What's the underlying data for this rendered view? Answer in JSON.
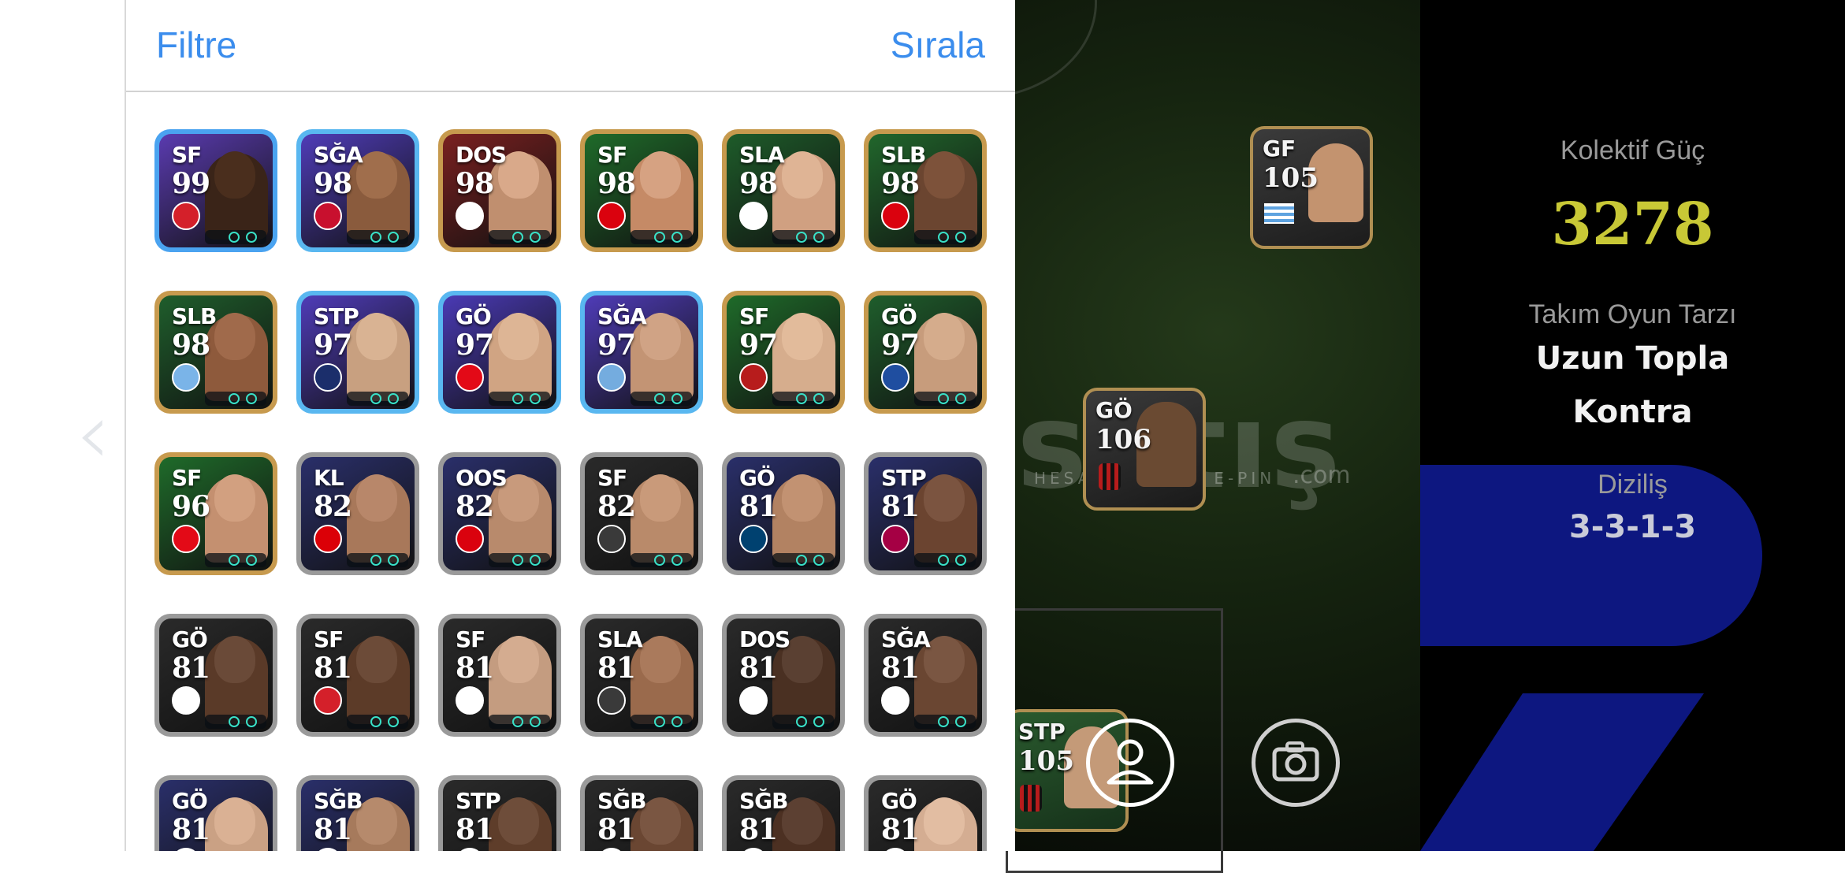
{
  "header": {
    "filter_label": "Filtre",
    "sort_label": "Sırala"
  },
  "players": [
    {
      "pos": "SF",
      "rating": "99",
      "bg": "#5a3bb0",
      "frame": "#4aa3f0",
      "face": "#3a2418",
      "head": "#4a2e1d",
      "badge": "#d4202a",
      "badge_icon": "galatasaray-badge-icon"
    },
    {
      "pos": "SĞA",
      "rating": "98",
      "bg": "#4f3cb8",
      "frame": "#59b7f0",
      "face": "#8a5b3d",
      "head": "#a06e4c",
      "badge": "#c8102e",
      "badge_icon": "portugal-flag-icon"
    },
    {
      "pos": "DOS",
      "rating": "98",
      "bg": "#7a2020",
      "frame": "#c79a4e",
      "face": "#c08f6f",
      "head": "#d9a98a",
      "badge": "#ffffff",
      "badge_icon": "ajax-badge-icon"
    },
    {
      "pos": "SF",
      "rating": "98",
      "bg": "#1f6b2a",
      "frame": "#c79a4e",
      "face": "#c58a66",
      "head": "#d6a282",
      "badge": "#da020e",
      "badge_icon": "man-united-badge-icon"
    },
    {
      "pos": "SLA",
      "rating": "98",
      "bg": "#1e5c2a",
      "frame": "#c79a4e",
      "face": "#d0a081",
      "head": "#dfb495",
      "badge": "#ffffff",
      "badge_icon": "club-badge-icon"
    },
    {
      "pos": "SLB",
      "rating": "98",
      "bg": "#21672c",
      "frame": "#c79a4e",
      "face": "#6b4530",
      "head": "#7d523a",
      "badge": "#da020e",
      "badge_icon": "man-united-badge-icon"
    },
    {
      "pos": "SLB",
      "rating": "98",
      "bg": "#1f5e2c",
      "frame": "#c79a4e",
      "face": "#8e5a3c",
      "head": "#a06a4b",
      "badge": "#7ab4e8",
      "badge_icon": "uruguay-flag-icon"
    },
    {
      "pos": "STP",
      "rating": "97",
      "bg": "#4f3cb8",
      "frame": "#59b7f0",
      "face": "#c8a080",
      "head": "#d9b393",
      "badge": "#1b2e6b",
      "badge_icon": "fenerbahce-badge-icon"
    },
    {
      "pos": "GÖ",
      "rating": "97",
      "bg": "#4a3ab5",
      "frame": "#59b7f0",
      "face": "#d0a483",
      "head": "#ddb595",
      "badge": "#e30a17",
      "badge_icon": "turkey-flag-icon"
    },
    {
      "pos": "SĞA",
      "rating": "97",
      "bg": "#4f3cb8",
      "frame": "#59b7f0",
      "face": "#c39474",
      "head": "#d0a385",
      "badge": "#74acdf",
      "badge_icon": "argentina-flag-icon"
    },
    {
      "pos": "SF",
      "rating": "97",
      "bg": "#1f6b2a",
      "frame": "#c79a4e",
      "face": "#d6ad8d",
      "head": "#e2bb9b",
      "badge": "#b71c1c",
      "badge_icon": "ac-milan-badge-icon"
    },
    {
      "pos": "GÖ",
      "rating": "97",
      "bg": "#1f5e2c",
      "frame": "#c79a4e",
      "face": "#c79c7c",
      "head": "#d5ac8c",
      "badge": "#1f4ea0",
      "badge_icon": "la-galaxy-badge-icon"
    },
    {
      "pos": "SF",
      "rating": "96",
      "bg": "#1f6b2a",
      "frame": "#c79a4e",
      "face": "#c49070",
      "head": "#d2a080",
      "badge": "#e30a17",
      "badge_icon": "turkey-flag-icon"
    },
    {
      "pos": "KL",
      "rating": "82",
      "bg": "#2a2f6a",
      "frame": "#9a9a9a",
      "face": "#a8785a",
      "head": "#b8876a",
      "badge": "#db0007",
      "badge_icon": "arsenal-badge-icon"
    },
    {
      "pos": "OOS",
      "rating": "82",
      "bg": "#2a2f6a",
      "frame": "#9a9a9a",
      "face": "#b88a6c",
      "head": "#c89a7c",
      "badge": "#da020e",
      "badge_icon": "man-united-badge-icon"
    },
    {
      "pos": "SF",
      "rating": "82",
      "bg": "#2a2a2a",
      "frame": "#9a9a9a",
      "face": "#b98a6a",
      "head": "#c99a7a",
      "badge": "#3a3a3a",
      "badge_icon": "shield-icon"
    },
    {
      "pos": "GÖ",
      "rating": "81",
      "bg": "#2a2f6a",
      "frame": "#9a9a9a",
      "face": "#b28262",
      "head": "#c29272",
      "badge": "#004170",
      "badge_icon": "psg-badge-icon"
    },
    {
      "pos": "STP",
      "rating": "81",
      "bg": "#2a2f6a",
      "frame": "#9a9a9a",
      "face": "#6b4430",
      "head": "#7b5440",
      "badge": "#a50044",
      "badge_icon": "barcelona-badge-icon"
    },
    {
      "pos": "GÖ",
      "rating": "81",
      "bg": "#2a2a2a",
      "frame": "#9a9a9a",
      "face": "#5a3a28",
      "head": "#6a4a38",
      "badge": "#ffffff",
      "badge_icon": "club-badge-icon"
    },
    {
      "pos": "SF",
      "rating": "81",
      "bg": "#2a2a2a",
      "frame": "#9a9a9a",
      "face": "#5c3b28",
      "head": "#6c4b38",
      "badge": "#d4202a",
      "badge_icon": "galatasaray-badge-icon"
    },
    {
      "pos": "SF",
      "rating": "81",
      "bg": "#2a2a2a",
      "frame": "#9a9a9a",
      "face": "#c49c80",
      "head": "#d4ac90",
      "badge": "#ffffff",
      "badge_icon": "club-badge-icon"
    },
    {
      "pos": "SLA",
      "rating": "81",
      "bg": "#2a2a2a",
      "frame": "#9a9a9a",
      "face": "#9a6a4c",
      "head": "#aa7a5c",
      "badge": "#3a3a3a",
      "badge_icon": "shield-icon"
    },
    {
      "pos": "DOS",
      "rating": "81",
      "bg": "#2a2a2a",
      "frame": "#9a9a9a",
      "face": "#4a3022",
      "head": "#5a4032",
      "badge": "#ffffff",
      "badge_icon": "club-badge-icon"
    },
    {
      "pos": "SĞA",
      "rating": "81",
      "bg": "#2a2a2a",
      "frame": "#9a9a9a",
      "face": "#6a4632",
      "head": "#7a5642",
      "badge": "#ffffff",
      "badge_icon": "club-badge-icon"
    },
    {
      "pos": "GÖ",
      "rating": "81",
      "bg": "#2a2f6a",
      "frame": "#9a9a9a",
      "face": "#caa184",
      "head": "#dab194",
      "badge": "#ffffff",
      "badge_icon": "club-badge-icon"
    },
    {
      "pos": "SĞB",
      "rating": "81",
      "bg": "#2a2f6a",
      "frame": "#9a9a9a",
      "face": "#a67a5c",
      "head": "#b68a6c",
      "badge": "#ffffff",
      "badge_icon": "club-badge-icon"
    },
    {
      "pos": "STP",
      "rating": "81",
      "bg": "#2a2a2a",
      "frame": "#9a9a9a",
      "face": "#5e3d2a",
      "head": "#6e4d3a",
      "badge": "#ffffff",
      "badge_icon": "club-badge-icon"
    },
    {
      "pos": "SĞB",
      "rating": "81",
      "bg": "#2a2a2a",
      "frame": "#9a9a9a",
      "face": "#6a4632",
      "head": "#7a5642",
      "badge": "#ffffff",
      "badge_icon": "club-badge-icon"
    },
    {
      "pos": "SĞB",
      "rating": "81",
      "bg": "#2a2a2a",
      "frame": "#9a9a9a",
      "face": "#4c3022",
      "head": "#5c4032",
      "badge": "#ffffff",
      "badge_icon": "club-badge-icon"
    },
    {
      "pos": "GÖ",
      "rating": "81",
      "bg": "#2a2a2a",
      "frame": "#9a9a9a",
      "face": "#d4ad92",
      "head": "#e2bda2",
      "badge": "#ffffff",
      "badge_icon": "club-badge-icon"
    }
  ],
  "field": {
    "players": [
      {
        "pos": "GF",
        "rating": "105",
        "badge_icon": "uruguay-flag-icon"
      },
      {
        "pos": "GÖ",
        "rating": "106",
        "badge_icon": "ac-milan-badge-icon"
      },
      {
        "pos": "STP",
        "rating": "105",
        "badge_icon": "ac-milan-badge-icon"
      }
    ],
    "profile_icon": "person-icon",
    "camera_icon": "camera-icon"
  },
  "watermark": {
    "brand": "satış",
    "sub": "HESAP / ITEM / E-PIN",
    "suffix": ".com"
  },
  "stats": {
    "team_strength_label": "Kolektif Güç",
    "team_strength_value": "3278",
    "playstyle_label": "Takım Oyun Tarzı",
    "playstyle_line1": "Uzun Topla",
    "playstyle_line2": "Kontra",
    "formation_label": "Diziliş",
    "formation_value": "3-3-1-3"
  },
  "colors": {
    "accent_blue": "#3b8ded",
    "gold": "#c8c836",
    "formation_blue": "#0d1780"
  }
}
